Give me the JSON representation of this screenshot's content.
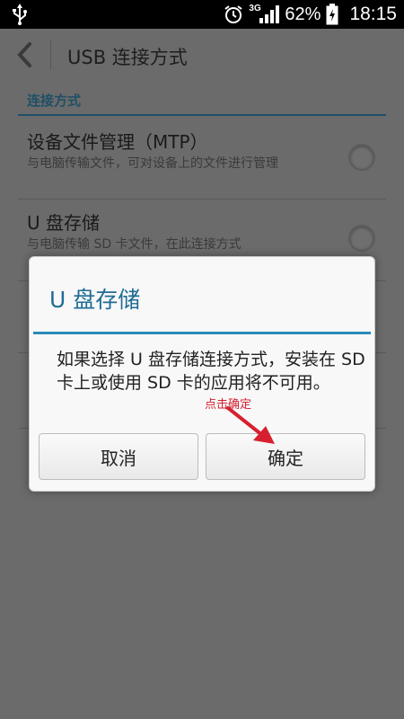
{
  "status_bar": {
    "network_type": "3G",
    "battery_percent": "62%",
    "time": "18:15",
    "icons": [
      "usb-icon",
      "alarm-clock-icon",
      "signal-icon",
      "battery-charging-icon"
    ]
  },
  "action_bar": {
    "title": "USB 连接方式",
    "back_icon": "chevron-left-icon"
  },
  "section": {
    "header": "连接方式",
    "options": [
      {
        "title": "设备文件管理（MTP）",
        "description": "与电脑传输文件，可对设备上的文件进行管理",
        "selected": false
      },
      {
        "title": "U 盘存储",
        "description": "与电脑传输 SD 卡文件，在此连接方式",
        "selected": false
      }
    ]
  },
  "dialog": {
    "title": "U 盘存储",
    "message": "如果选择 U 盘存储连接方式，安装在 SD 卡上或使用 SD 卡的应用将不可用。",
    "cancel_label": "取消",
    "confirm_label": "确定"
  },
  "annotation": {
    "text": "点击确定",
    "color": "#d6202f"
  },
  "colors": {
    "accent": "#2a8ab8",
    "overlay": "#6b6b6b",
    "dialog_bg": "#f8f8f8"
  }
}
